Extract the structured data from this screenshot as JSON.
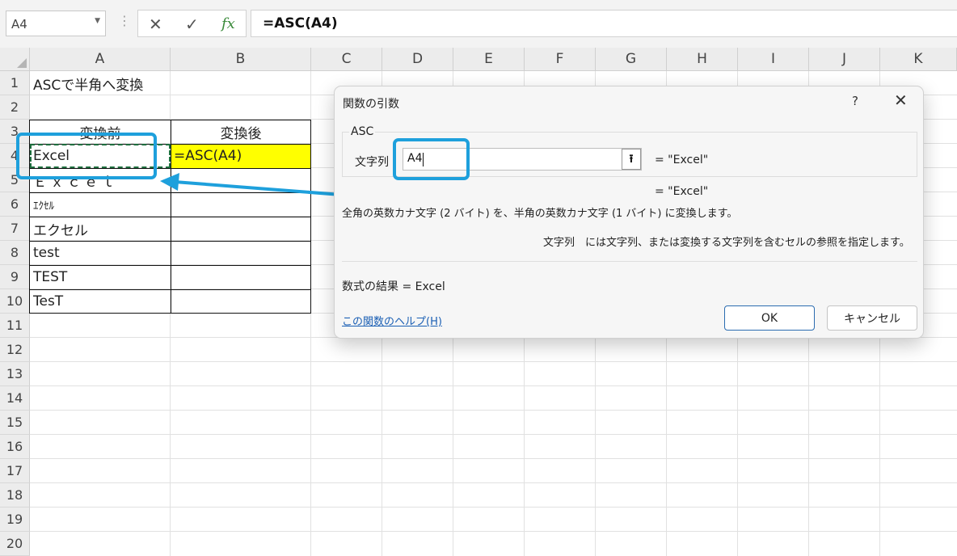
{
  "formula_bar": {
    "name_box": "A4",
    "cancel_icon": "✕",
    "enter_icon": "✓",
    "fx_label": "fx",
    "formula": "=ASC(A4)"
  },
  "columns": [
    "A",
    "B",
    "C",
    "D",
    "E",
    "F",
    "G",
    "H",
    "I",
    "J",
    "K"
  ],
  "rows": [
    "1",
    "2",
    "3",
    "4",
    "5",
    "6",
    "7",
    "8",
    "9",
    "10",
    "11",
    "12",
    "13",
    "14",
    "15",
    "16",
    "17",
    "18",
    "19",
    "20"
  ],
  "cells": {
    "a1": "ASCで半角へ変換",
    "a3": "変換前",
    "b3": "変換後",
    "a4": "Excel",
    "b4": "=ASC(A4)",
    "a5": "Ｅｘｃｅｌ",
    "a6": "ｴｸｾﾙ",
    "a7": "エクセル",
    "a8": "test",
    "a9": "TEST",
    "a10": "TesT"
  },
  "dialog": {
    "title": "関数の引数",
    "help_glyph": "?",
    "close_glyph": "✕",
    "function_name": "ASC",
    "arg_label": "文字列",
    "arg_value": "A4",
    "ref_glyph": "⭱",
    "arg_result": "=    \"Excel\"",
    "func_result": "=    \"Excel\"",
    "description": "全角の英数カナ文字 (2 バイト) を、半角の英数カナ文字 (1 バイト) に変換します。",
    "arg_description": "文字列　には文字列、または変換する文字列を含むセルの参照を指定します。",
    "formula_result": "数式の結果 =    Excel",
    "help_link": "この関数のヘルプ(H)",
    "ok_label": "OK",
    "cancel_label": "キャンセル"
  },
  "colors": {
    "highlight": "#ffff00",
    "callout": "#1ea0dc",
    "marching_ants": "#1e6e3e",
    "link": "#1a5fb4"
  }
}
